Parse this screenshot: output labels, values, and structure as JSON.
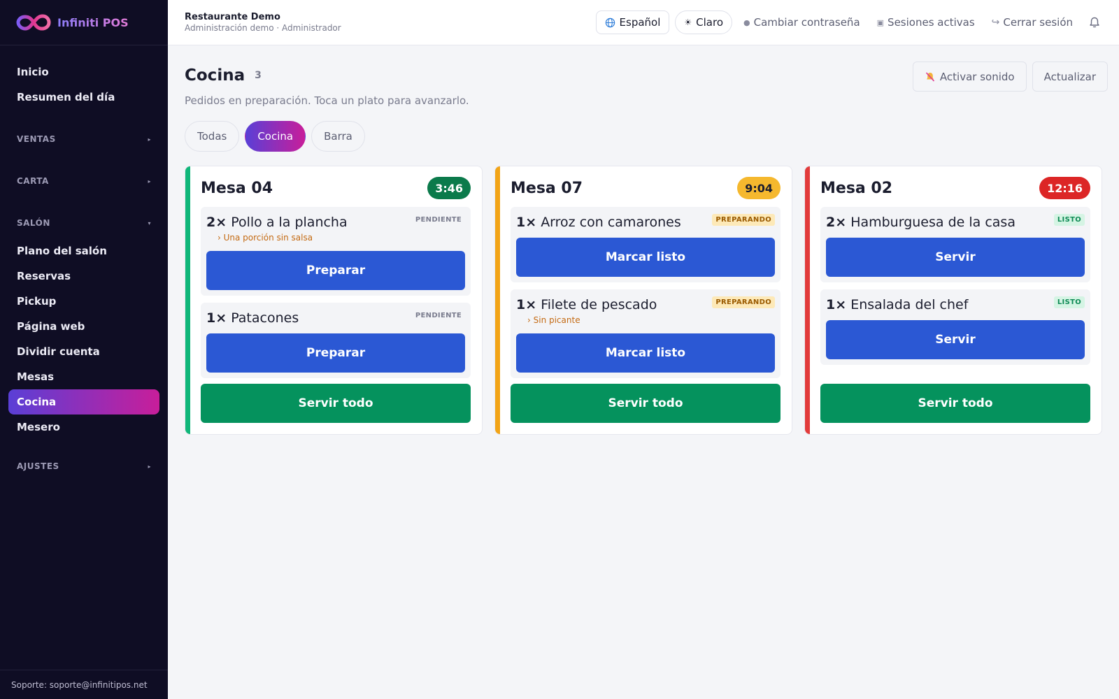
{
  "app": {
    "name": "Infiniti POS"
  },
  "sidebar": {
    "top_items": [
      {
        "label": "Inicio"
      },
      {
        "label": "Resumen del día"
      }
    ],
    "sections": {
      "ventas": "VENTAS",
      "carta": "CARTA",
      "salon": "SALÓN",
      "ajustes": "AJUSTES"
    },
    "salon_items": [
      {
        "label": "Plano del salón"
      },
      {
        "label": "Reservas"
      },
      {
        "label": "Pickup"
      },
      {
        "label": "Página web"
      },
      {
        "label": "Dividir cuenta"
      },
      {
        "label": "Mesas"
      },
      {
        "label": "Cocina",
        "active": true
      },
      {
        "label": "Mesero"
      }
    ],
    "support": "Soporte: soporte@infinitipos.net"
  },
  "topbar": {
    "org_name": "Restaurante Demo",
    "org_sub": "Administración demo · Administrador",
    "language": "Español",
    "theme": "Claro",
    "change_password": "Cambiar contraseña",
    "active_sessions": "Sesiones activas",
    "logout": "Cerrar sesión"
  },
  "page": {
    "title": "Cocina",
    "count": "3",
    "subtitle": "Pedidos en preparación. Toca un plato para avanzarlo.",
    "sound_button": "Activar sonido",
    "refresh_button": "Actualizar",
    "filters": [
      {
        "label": "Todas"
      },
      {
        "label": "Cocina",
        "active": true
      },
      {
        "label": "Barra"
      }
    ]
  },
  "colors": {
    "accent_gradient_start": "#5a3fd6",
    "accent_gradient_end": "#c81e9a",
    "primary_button": "#2b58d4",
    "serve_all_button": "#05925d",
    "status_green": "#0b7a4b",
    "status_amber": "#f5b82e",
    "status_red": "#dc2626"
  },
  "orders": [
    {
      "table": "Mesa 04",
      "timer": "3:46",
      "items": [
        {
          "qty": "2×",
          "name": "Pollo a la plancha",
          "status": "PENDIENTE",
          "note": "› Una porción sin salsa",
          "action": "Preparar"
        },
        {
          "qty": "1×",
          "name": "Patacones",
          "status": "PENDIENTE",
          "note": "",
          "action": "Preparar"
        }
      ],
      "serve_all": "Servir todo"
    },
    {
      "table": "Mesa 07",
      "timer": "9:04",
      "items": [
        {
          "qty": "1×",
          "name": "Arroz con camarones",
          "status": "PREPARANDO",
          "note": "",
          "action": "Marcar listo"
        },
        {
          "qty": "1×",
          "name": "Filete de pescado",
          "status": "PREPARANDO",
          "note": "› Sin picante",
          "action": "Marcar listo"
        }
      ],
      "serve_all": "Servir todo"
    },
    {
      "table": "Mesa 02",
      "timer": "12:16",
      "items": [
        {
          "qty": "2×",
          "name": "Hamburguesa de la casa",
          "status": "LISTO",
          "note": "",
          "action": "Servir"
        },
        {
          "qty": "1×",
          "name": "Ensalada del chef",
          "status": "LISTO",
          "note": "",
          "action": "Servir"
        }
      ],
      "serve_all": "Servir todo"
    }
  ]
}
